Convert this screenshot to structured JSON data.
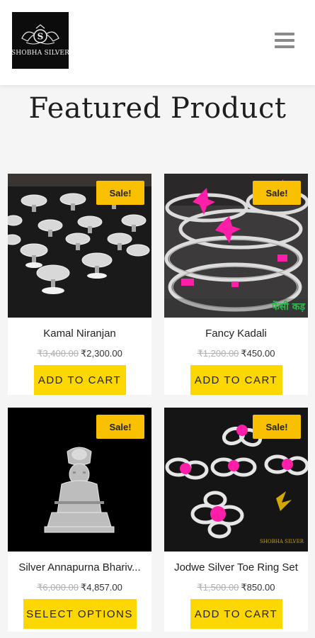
{
  "header": {
    "logo_text": "SHOBHA SILVER"
  },
  "section": {
    "title": "Featured Product"
  },
  "products": [
    {
      "title": "Kamal Niranjan",
      "old_price": "₹3,400.00",
      "new_price": "₹2,300.00",
      "badge": "Sale!",
      "button": "ADD TO CART"
    },
    {
      "title": "Fancy Kadali",
      "old_price": "₹1,200.00",
      "new_price": "₹450.00",
      "badge": "Sale!",
      "button": "ADD TO CART",
      "image_text": "फेंसी कड़"
    },
    {
      "title": "Silver Annapurna Bhariv...",
      "old_price": "₹6,000.00",
      "new_price": "₹4,857.00",
      "badge": "Sale!",
      "button": "SELECT OPTIONS"
    },
    {
      "title": "Jodwe Silver Toe Ring Set",
      "old_price": "₹1,500.00",
      "new_price": "₹850.00",
      "badge": "Sale!",
      "button": "ADD TO CART",
      "image_text": "SHOBHA SILVER"
    }
  ],
  "colors": {
    "badge": "#f9c000",
    "button": "#fcd800",
    "background": "#f5f5f5"
  }
}
